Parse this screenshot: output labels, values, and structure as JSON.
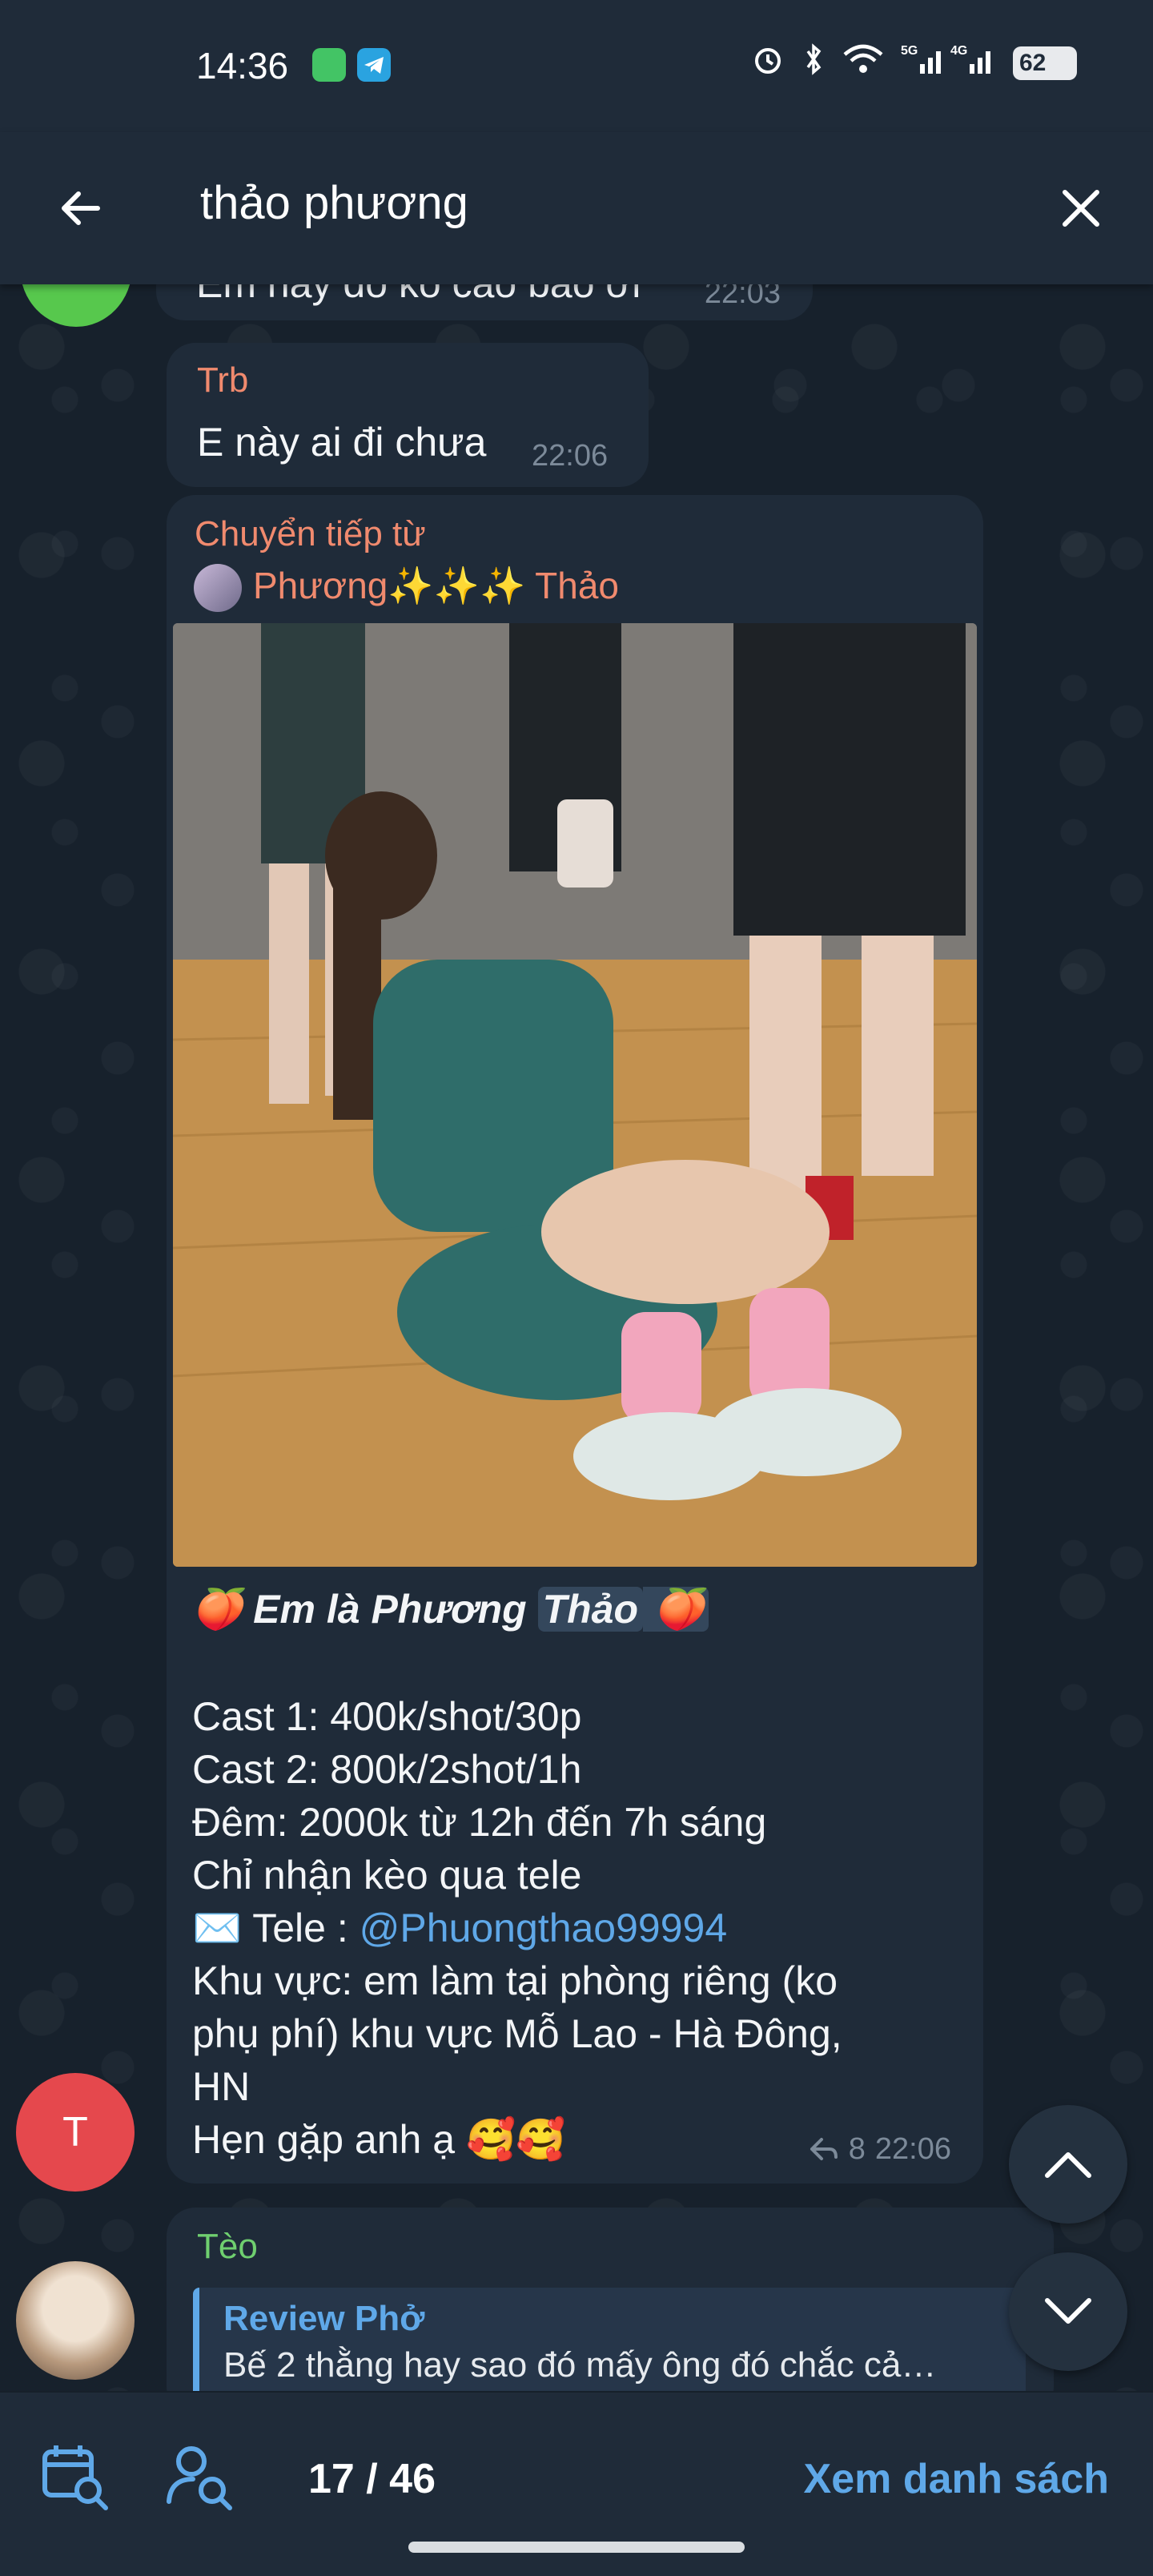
{
  "status_bar": {
    "time": "14:36",
    "network": "5G 4G",
    "battery": "62",
    "icons": [
      "messages-app-icon",
      "telegram-app-icon",
      "alarm-icon",
      "bluetooth-icon",
      "wifi-icon",
      "signal-icon",
      "battery-icon"
    ]
  },
  "search": {
    "query": "thảo phương",
    "back_icon": "arrow-left-icon",
    "clear_icon": "close-icon"
  },
  "messages": {
    "partial": {
      "text": "Em hay đo ko cao bao ơi",
      "time": "22:03"
    },
    "trb": {
      "sender": "Trb",
      "text": "E này ai đi chưa",
      "time": "22:06"
    },
    "forwarded": {
      "forward_label": "Chuyển tiếp từ",
      "origin_name": "Phương✨✨✨ Thảo",
      "caption": {
        "title_prefix": "🍑 ",
        "title_main": "Em là Phương ",
        "title_highlight": "Thảo",
        "title_suffix": " 🍑",
        "line1": "Cast 1: 400k/shot/30p",
        "line2": "Cast 2: 800k/2shot/1h",
        "line3": "Đêm: 2000k từ 12h đến 7h sáng",
        "line4": "Chỉ nhận kèo qua tele",
        "tele_label": "✉️ Tele : ",
        "tele_handle": "@Phuongthao99994",
        "line6": "Khu vực: em làm tại phòng riêng (ko",
        "line7": "phụ phí) khu vực Mỗ Lao - Hà Đông,",
        "line8": "HN",
        "line9": "Hẹn gặp anh ạ 🥰🥰"
      },
      "forwards_count": "8",
      "time": "22:06"
    },
    "avatar_t_letter": "T",
    "teo": {
      "sender": "Tèo",
      "reply_name": "Review Phở",
      "reply_text": "Bế 2 thằng hay sao đó mấy ông đó chắc cả…"
    }
  },
  "bottom_bar": {
    "counter": "17 / 46",
    "list_button": "Xem danh sách"
  },
  "colors": {
    "accent_blue": "#5fa8e8",
    "sender_orange": "#f08a6e",
    "sender_green": "#6fcf6f",
    "avatar_red": "#e5484d",
    "avatar_green": "#57c84d"
  }
}
